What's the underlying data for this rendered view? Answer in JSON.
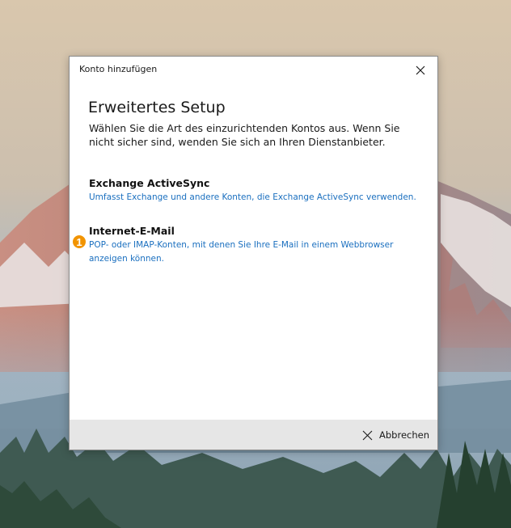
{
  "dialog": {
    "title": "Konto hinzufügen",
    "heading": "Erweitertes Setup",
    "description": "Wählen Sie die Art des einzurichtenden Kontos aus. Wenn Sie nicht sicher sind, wenden Sie sich an Ihren Dienstanbieter.",
    "options": [
      {
        "title": "Exchange ActiveSync",
        "subtitle": "Umfasst Exchange und andere Konten, die Exchange ActiveSync verwenden."
      },
      {
        "title": "Internet-E-Mail",
        "subtitle": "POP- oder IMAP-Konten, mit denen Sie Ihre E-Mail in einem Webbrowser anzeigen können."
      }
    ],
    "cancel_label": "Abbrechen",
    "close_icon": "close-icon"
  },
  "annotation": {
    "badge_number": "1",
    "badge_color": "#f29400"
  },
  "colors": {
    "link_blue": "#1a6fbf",
    "footer_gray": "#e6e6e6"
  }
}
